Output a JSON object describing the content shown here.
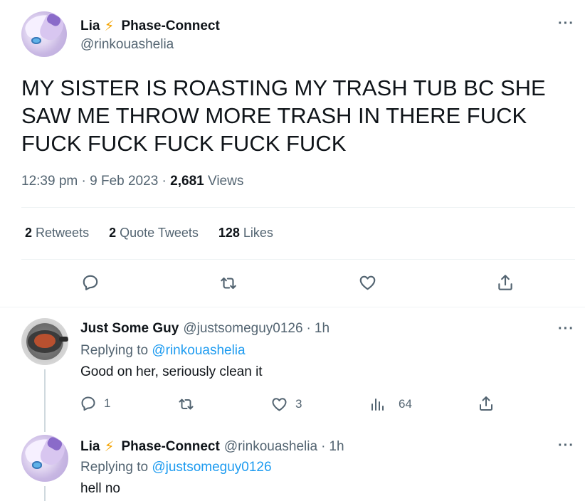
{
  "main_tweet": {
    "author_name": "Lia",
    "author_emoji": "⚡",
    "author_suffix": "Phase-Connect",
    "author_handle": "@rinkouashelia",
    "text_line1": "MY SISTER IS ROASTING MY TRASH TUB BC SHE",
    "text_line2": "SAW ME THROW MORE TRASH IN THERE FUCK",
    "text_line3": "FUCK FUCK FUCK FUCK FUCK",
    "time": "12:39 pm",
    "date": "9 Feb 2023",
    "views_count": "2,681",
    "views_label": "Views",
    "retweets_count": "2",
    "retweets_label": "Retweets",
    "quotes_count": "2",
    "quotes_label": "Quote Tweets",
    "likes_count": "128",
    "likes_label": "Likes"
  },
  "replies": [
    {
      "author_name": "Just Some Guy",
      "author_handle": "@justsomeguy0126",
      "time": "1h",
      "replying_prefix": "Replying to",
      "replying_to": "@rinkouashelia",
      "text": "Good on her, seriously clean it",
      "reply_count": "1",
      "retweet_count": "",
      "like_count": "3",
      "view_count": "64"
    },
    {
      "author_name": "Lia",
      "author_emoji": "⚡",
      "author_suffix": "Phase-Connect",
      "author_handle": "@rinkouashelia",
      "time": "1h",
      "replying_prefix": "Replying to",
      "replying_to": "@justsomeguy0126",
      "text": "hell no"
    }
  ],
  "separator_dot": "·",
  "more_glyph": "···",
  "colors": {
    "text": "#0f1419",
    "secondary": "#536471",
    "link": "#1d9bf0",
    "divider": "#eff3f4",
    "bolt": "#f4a300"
  },
  "icons": [
    "reply-icon",
    "retweet-icon",
    "like-icon",
    "share-icon",
    "views-icon",
    "more-icon",
    "lightning-icon"
  ]
}
